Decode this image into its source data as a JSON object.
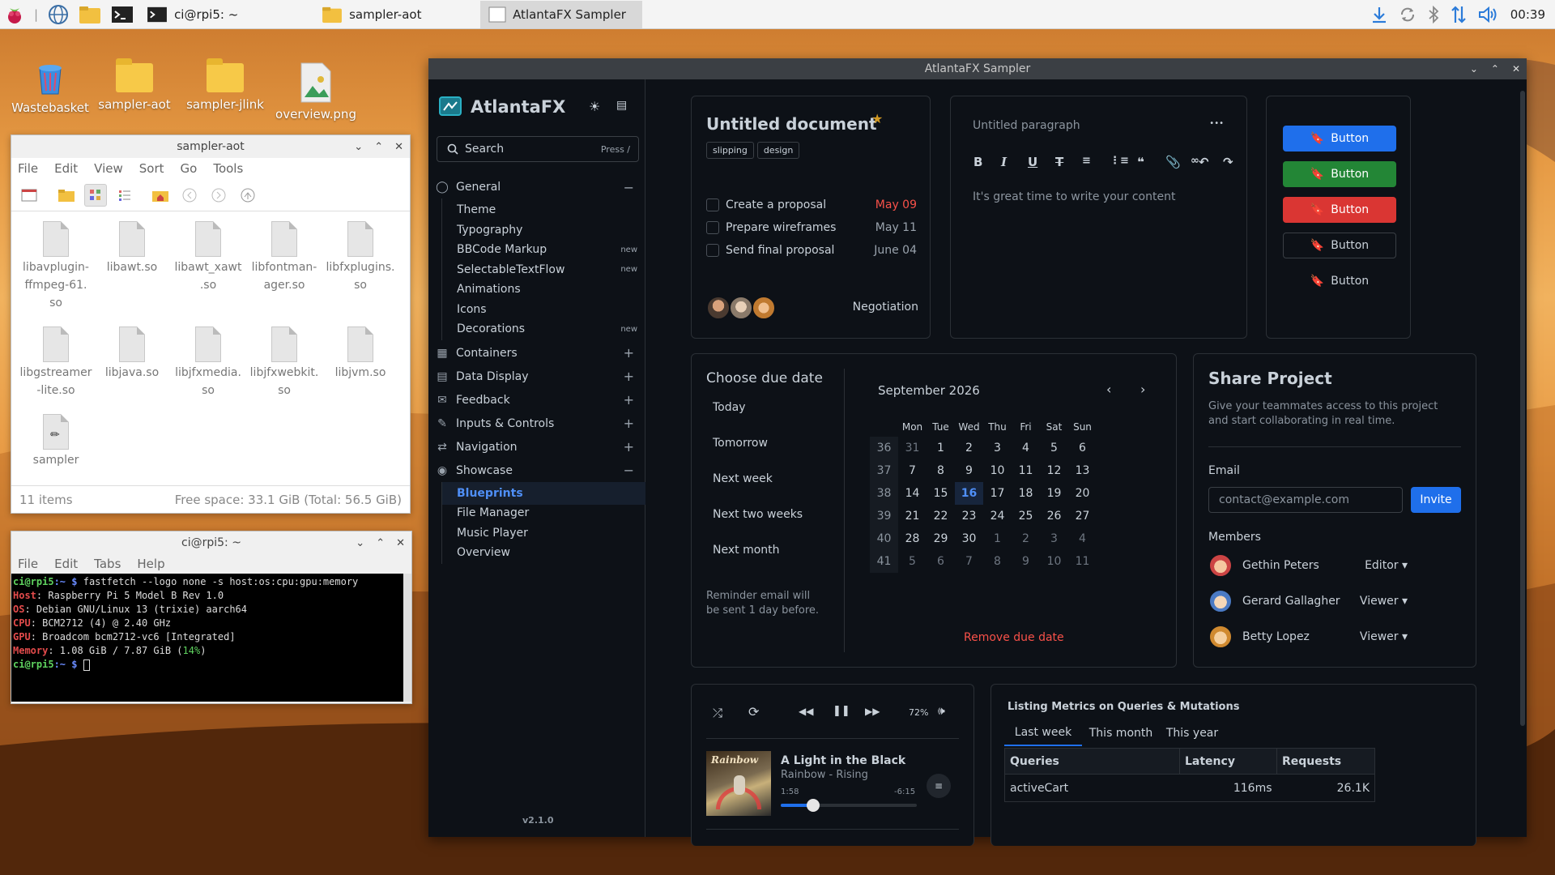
{
  "taskbar": {
    "tasks": [
      {
        "label": "ci@rpi5: ~",
        "active": false
      },
      {
        "label": "sampler-aot",
        "active": false
      },
      {
        "label": "AtlantaFX Sampler",
        "active": true
      }
    ],
    "clock": "00:39"
  },
  "desktop": {
    "icons": [
      "Wastebasket",
      "sampler-aot",
      "sampler-jlink",
      "overview.png"
    ]
  },
  "file_manager": {
    "title": "sampler-aot",
    "menu": [
      "File",
      "Edit",
      "View",
      "Sort",
      "Go",
      "Tools"
    ],
    "files": [
      "libavplugin-ffmpeg-61.so",
      "libawt.so",
      "libawt_xawt.so",
      "libfontmanager.so",
      "libfxplugins.so",
      "libgstreamer-lite.so",
      "libjava.so",
      "libjfxmedia.so",
      "libjfxwebkit.so",
      "libjvm.so",
      "sampler"
    ],
    "file_labels": [
      [
        "libavplugin-",
        "ffmpeg-61.",
        "so"
      ],
      [
        "libawt.so"
      ],
      [
        "libawt_xawt",
        ".so"
      ],
      [
        "libfontman-",
        "ager.so"
      ],
      [
        "libfxplugins.",
        "so"
      ],
      [
        "libgstreamer",
        "-lite.so"
      ],
      [
        "libjava.so"
      ],
      [
        "libjfxmedia.",
        "so"
      ],
      [
        "libjfxwebkit.",
        "so"
      ],
      [
        "libjvm.so"
      ],
      [
        "sampler"
      ]
    ],
    "item_count": "11 items",
    "free_space": "Free space: 33.1 GiB (Total: 56.5 GiB)"
  },
  "terminal": {
    "title": "ci@rpi5: ~",
    "menu": [
      "File",
      "Edit",
      "Tabs",
      "Help"
    ],
    "prompt_user": "ci@rpi5",
    "prompt_path": ":~ $",
    "command": "fastfetch --logo none -s host:os:cpu:gpu:memory",
    "lines": [
      {
        "key": "Host",
        "value": ": Raspberry Pi 5 Model B Rev 1.0"
      },
      {
        "key": "OS",
        "value": ": Debian GNU/Linux 13 (trixie) aarch64"
      },
      {
        "key": "CPU",
        "value": ": BCM2712 (4) @ 2.40 GHz"
      },
      {
        "key": "GPU",
        "value": ": Broadcom bcm2712-vc6 [Integrated]"
      },
      {
        "key": "Memory",
        "value": ": 1.08 GiB / 7.87 GiB ("
      },
      {
        "pct": "14%"
      }
    ]
  },
  "app": {
    "title": "AtlantaFX Sampler",
    "brand": "AtlantaFX",
    "search_label": "Search",
    "search_hint": "Press /",
    "version": "v2.1.0",
    "nav": {
      "general": "General",
      "general_items": [
        {
          "label": "Theme",
          "new": ""
        },
        {
          "label": "Typography",
          "new": ""
        },
        {
          "label": "BBCode Markup",
          "new": "new"
        },
        {
          "label": "SelectableTextFlow",
          "new": "new"
        },
        {
          "label": "Animations",
          "new": ""
        },
        {
          "label": "Icons",
          "new": ""
        },
        {
          "label": "Decorations",
          "new": "new"
        }
      ],
      "sections": [
        "Containers",
        "Data Display",
        "Feedback",
        "Inputs & Controls",
        "Navigation"
      ],
      "showcase": "Showcase",
      "showcase_items": [
        "Blueprints",
        "File Manager",
        "Music Player",
        "Overview"
      ]
    },
    "doc_card": {
      "title": "Untitled document",
      "tags": [
        "slipping",
        "design"
      ],
      "todos": [
        {
          "label": "Create a proposal",
          "date": "May 09",
          "overdue": true
        },
        {
          "label": "Prepare wireframes",
          "date": "May 11",
          "overdue": false
        },
        {
          "label": "Send final proposal",
          "date": "June 04",
          "overdue": false
        }
      ],
      "status": "Negotiation"
    },
    "editor": {
      "placeholder_title": "Untitled paragraph",
      "menu": "•••",
      "body": "It's great time to write your content"
    },
    "buttons": {
      "label": "Button",
      "variants": [
        "accent",
        "success",
        "danger",
        "default",
        "flat"
      ]
    },
    "due_date": {
      "title": "Choose due date",
      "options": [
        "Today",
        "Tomorrow",
        "Next week",
        "Next two weeks",
        "Next month"
      ],
      "reminder": [
        "Reminder email will",
        "be sent 1 day before."
      ],
      "month": "September  2026",
      "weekdays": [
        "Mon",
        "Tue",
        "Wed",
        "Thu",
        "Fri",
        "Sat",
        "Sun"
      ],
      "weeks": [
        {
          "wk": "36",
          "days": [
            "31",
            "1",
            "2",
            "3",
            "4",
            "5",
            "6"
          ]
        },
        {
          "wk": "37",
          "days": [
            "7",
            "8",
            "9",
            "10",
            "11",
            "12",
            "13"
          ]
        },
        {
          "wk": "38",
          "days": [
            "14",
            "15",
            "16",
            "17",
            "18",
            "19",
            "20"
          ]
        },
        {
          "wk": "39",
          "days": [
            "21",
            "22",
            "23",
            "24",
            "25",
            "26",
            "27"
          ]
        },
        {
          "wk": "40",
          "days": [
            "28",
            "29",
            "30",
            "1",
            "2",
            "3",
            "4"
          ]
        },
        {
          "wk": "41",
          "days": [
            "5",
            "6",
            "7",
            "8",
            "9",
            "10",
            "11"
          ]
        }
      ],
      "selected_day": "16",
      "remove": "Remove due date"
    },
    "share": {
      "title": "Share Project",
      "subtitle": [
        "Give your teammates access to this project",
        "and start collaborating in real time."
      ],
      "email_label": "Email",
      "email_placeholder": "contact@example.com",
      "invite": "Invite",
      "members_label": "Members",
      "members": [
        {
          "name": "Gethin Peters",
          "role": "Editor"
        },
        {
          "name": "Gerard Gallagher",
          "role": "Viewer"
        },
        {
          "name": "Betty Lopez",
          "role": "Viewer"
        }
      ]
    },
    "player": {
      "volume": "72%",
      "track": "A Light in the Black",
      "artist": "Rainbow - Rising",
      "elapsed": "1:58",
      "remaining": "-6:15",
      "progress": 0.24,
      "cover_text": "Rainbow"
    },
    "metrics": {
      "title": "Listing Metrics on Queries & Mutations",
      "tabs": [
        "Last week",
        "This month",
        "This year"
      ],
      "columns": [
        "Queries",
        "Latency",
        "Requests"
      ],
      "rows": [
        [
          "activeCart",
          "116ms",
          "26.1K"
        ]
      ]
    }
  },
  "colors": {
    "accent": "#1f6feb",
    "success": "#238636",
    "danger": "#da3633",
    "star": "#d29922",
    "overdue": "#f85149"
  }
}
